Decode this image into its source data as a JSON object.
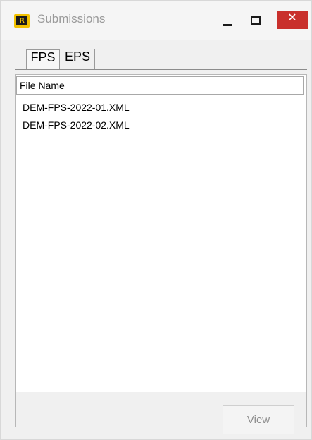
{
  "window": {
    "title": "Submissions",
    "icon": "app-logo-icon",
    "icon_letter": "R",
    "controls": {
      "minimize": "minimize-icon",
      "maximize": "maximize-icon",
      "close_label": "✕"
    }
  },
  "tabs": [
    {
      "label": "FPS",
      "active": true
    },
    {
      "label": "EPS",
      "active": false
    }
  ],
  "list": {
    "columns": [
      "File Name"
    ],
    "rows": [
      "DEM-FPS-2022-01.XML",
      "DEM-FPS-2022-02.XML"
    ]
  },
  "actions": {
    "view_label": "View"
  },
  "colors": {
    "close_button": "#c9302c",
    "logo_yellow": "#f2c200"
  }
}
